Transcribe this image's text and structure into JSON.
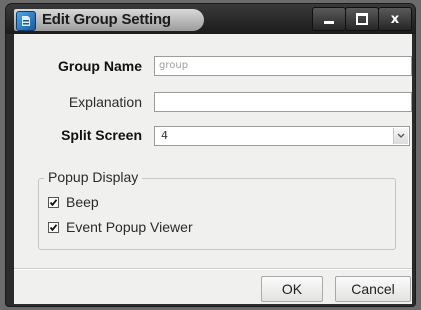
{
  "window": {
    "title": "Edit Group Setting",
    "close_glyph": "x"
  },
  "form": {
    "group_name_label": "Group Name",
    "group_name_value": "group",
    "explanation_label": "Explanation",
    "explanation_value": "",
    "split_screen_label": "Split Screen",
    "split_screen_value": "4"
  },
  "popup_display": {
    "legend": "Popup Display",
    "options": [
      {
        "label": "Beep",
        "checked": true
      },
      {
        "label": "Event Popup Viewer",
        "checked": true
      }
    ]
  },
  "buttons": {
    "ok": "OK",
    "cancel": "Cancel"
  },
  "icons": {
    "app": "app-icon",
    "minimize": "minimize-icon",
    "maximize": "maximize-icon",
    "close": "close-icon",
    "dropdown": "chevron-down-icon",
    "check": "check-icon"
  }
}
